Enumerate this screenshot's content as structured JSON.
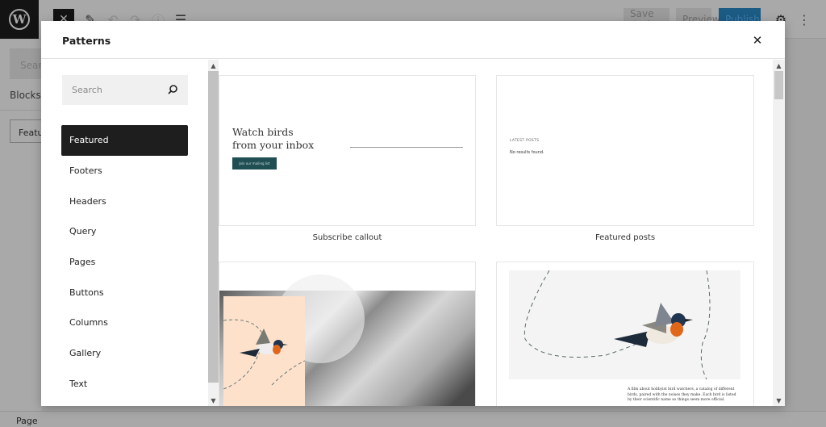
{
  "toolbar": {
    "close_icon": "✕",
    "save_draft": "Save draft",
    "preview": "Preview",
    "publish": "Publish",
    "colors": {
      "publish": "#007cba",
      "active": "#1e1e1e"
    }
  },
  "inserter_background": {
    "search_placeholder": "Search",
    "tab_blocks": "Blocks",
    "selected_category": "Featured"
  },
  "status_bar": {
    "breadcrumb": "Page"
  },
  "modal": {
    "title": "Patterns",
    "close_icon": "✕",
    "search": {
      "placeholder": "Search",
      "value": ""
    },
    "categories": [
      {
        "label": "Featured",
        "active": true
      },
      {
        "label": "Footers",
        "active": false
      },
      {
        "label": "Headers",
        "active": false
      },
      {
        "label": "Query",
        "active": false
      },
      {
        "label": "Pages",
        "active": false
      },
      {
        "label": "Buttons",
        "active": false
      },
      {
        "label": "Columns",
        "active": false
      },
      {
        "label": "Gallery",
        "active": false
      },
      {
        "label": "Text",
        "active": false
      }
    ],
    "patterns": [
      {
        "caption": "Subscribe callout",
        "heading_line1": "Watch birds",
        "heading_line2": "from your inbox",
        "button_label": "Join our mailing list"
      },
      {
        "caption": "Featured posts",
        "label": "LATEST POSTS",
        "empty_text": "No results found."
      },
      {
        "caption": "",
        "image": "bird-illustration-collage"
      },
      {
        "caption": "",
        "image": "bird-flying-dashed-path",
        "body_text": "A film about hobbyist bird watchers, a catalog of different birds, paired with the noises they make. Each bird is listed by their scientific name so things seem more official."
      }
    ]
  }
}
